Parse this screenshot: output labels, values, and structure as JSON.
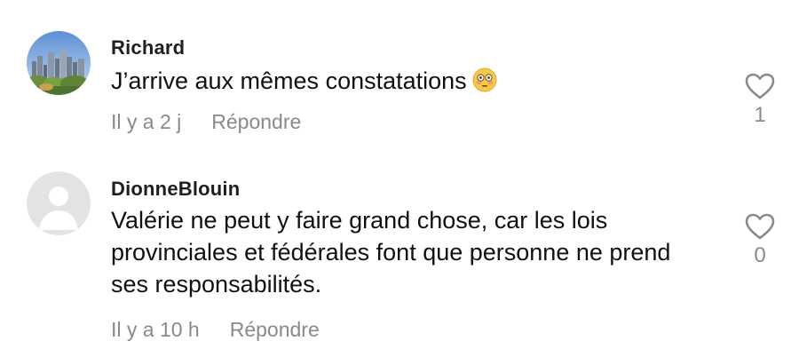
{
  "comments": [
    {
      "username": "Richard",
      "text": "J’arrive aux mêmes constatations",
      "emoji": "flushed-face-icon",
      "time": "Il y a 2 j",
      "reply_label": "Répondre",
      "likes": "1",
      "avatar": "city-skyline-photo"
    },
    {
      "username": "DionneBlouin",
      "text": "Valérie ne peut y faire grand chose, car les lois provinciales et fédérales font que personne ne prend ses responsabilités.",
      "time": "Il y a 10 h",
      "reply_label": "Répondre",
      "likes": "0",
      "avatar": "default-user-icon"
    }
  ],
  "colors": {
    "username": "#1f1f1f",
    "text": "#111111",
    "meta": "#8a8a8a",
    "avatar_default_bg": "#e3e3e3",
    "avatar_default_fg": "#ffffff"
  }
}
